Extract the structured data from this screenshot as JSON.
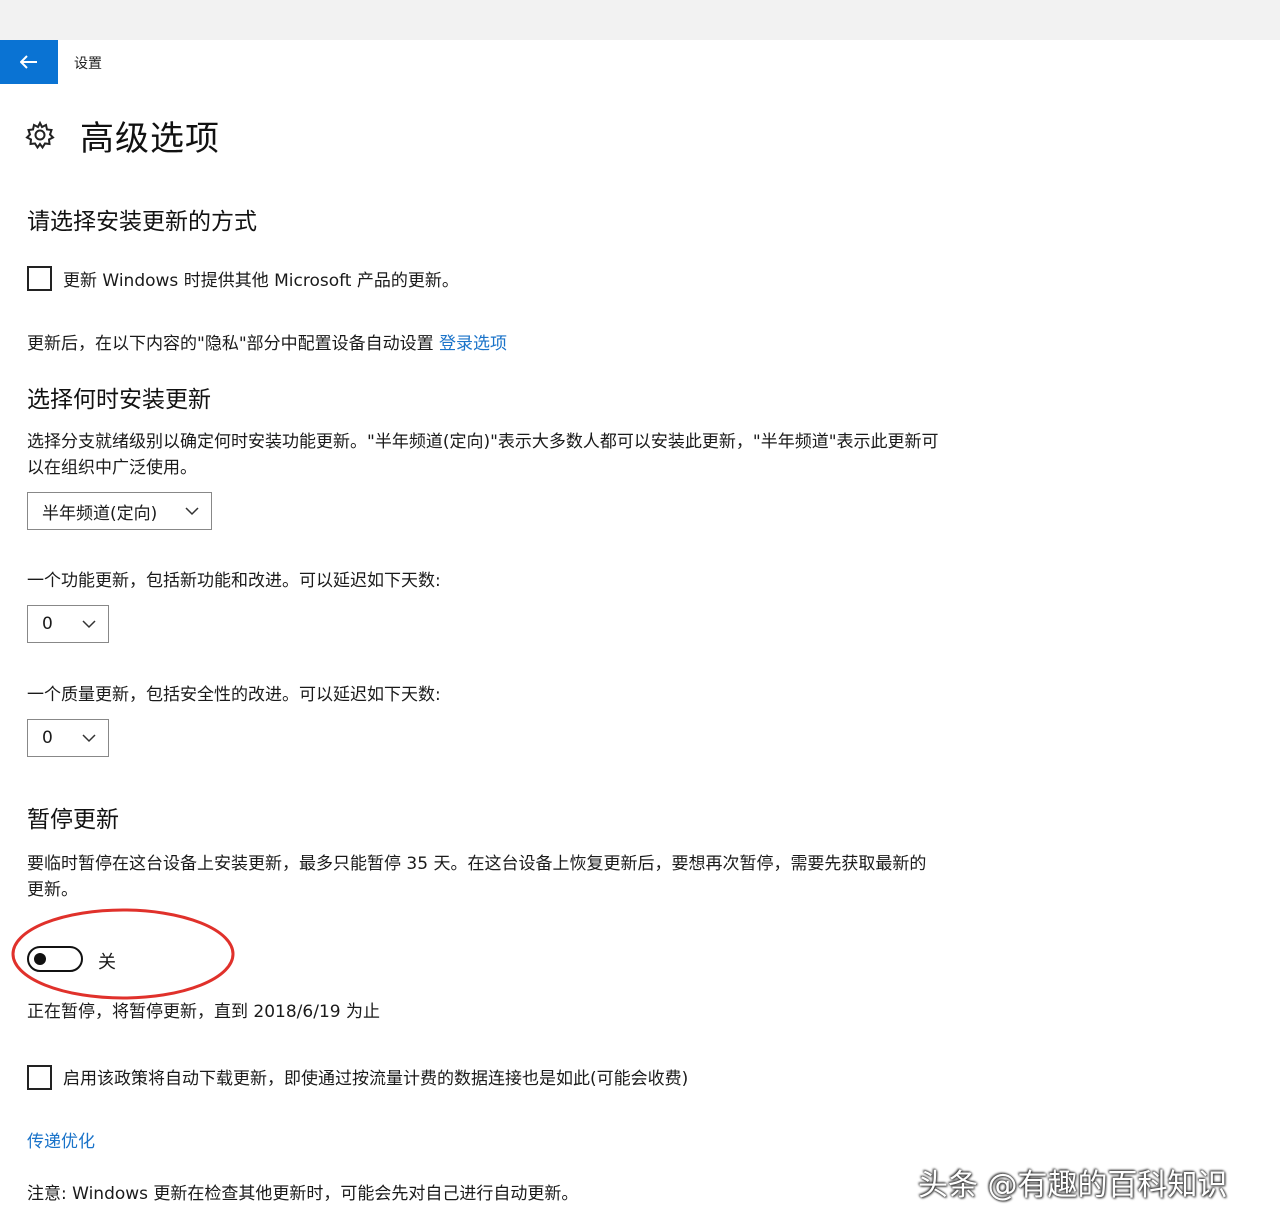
{
  "window": {
    "app_title": "设置",
    "back_icon": "arrow-left-icon",
    "accent_color": "#0a73d3"
  },
  "header": {
    "icon": "gear-icon",
    "title": "高级选项"
  },
  "install_method": {
    "heading": "请选择安装更新的方式",
    "checkbox_label": "更新 Windows 时提供其他 Microsoft 产品的更新。",
    "checkbox_checked": false,
    "privacy_text": "更新后，在以下内容的\"隐私\"部分中配置设备自动设置",
    "privacy_link": "登录选项"
  },
  "install_time": {
    "heading": "选择何时安装更新",
    "description_line1": "选择分支就绪级别以确定何时安装功能更新。\"半年频道(定向)\"表示大多数人都可以安装此更新，\"半年频道\"表示此更新可",
    "description_line2": "以在组织中广泛使用。",
    "branch_select_value": "半年频道(定向)",
    "feature_defer_label": "一个功能更新，包括新功能和改进。可以延迟如下天数:",
    "feature_defer_value": "0",
    "quality_defer_label": "一个质量更新，包括安全性的改进。可以延迟如下天数:",
    "quality_defer_value": "0"
  },
  "pause": {
    "heading": "暂停更新",
    "description_line1": "要临时暂停在这台设备上安装更新，最多只能暂停 35 天。在这台设备上恢复更新后，要想再次暂停，需要先获取最新的",
    "description_line2": "更新。",
    "toggle_state": "关",
    "toggle_on": false,
    "status_text": "正在暂停，将暂停更新，直到 2018/6/19 为止",
    "annotation_color": "#e0312b"
  },
  "metered": {
    "checkbox_label": "启用该政策将自动下载更新，即使通过按流量计费的数据连接也是如此(可能会收费)",
    "checkbox_checked": false
  },
  "delivery": {
    "link": "传递优化",
    "note": "注意: Windows 更新在检查其他更新时，可能会先对自己进行自动更新。"
  },
  "watermark": "头条 @有趣的百科知识"
}
